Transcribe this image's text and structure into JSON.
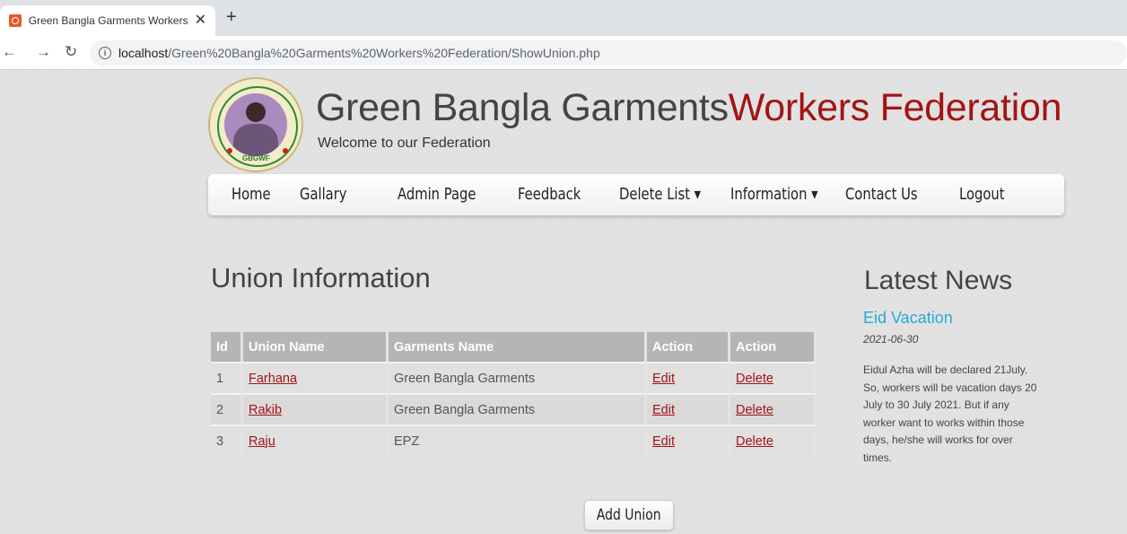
{
  "browser": {
    "tab_title": "Green Bangla Garments Workers",
    "url_host": "localhost",
    "url_path": "/Green%20Bangla%20Garments%20Workers%20Federation/ShowUnion.php"
  },
  "site": {
    "title_part1": "Green Bangla Garments",
    "title_part2": "Workers Federation",
    "subtitle": "Welcome to our Federation",
    "logo_abbr": "GBGWF"
  },
  "nav": {
    "items": [
      {
        "label": "Home"
      },
      {
        "label": "Gallary"
      },
      {
        "label": "Admin Page"
      },
      {
        "label": "Feedback"
      },
      {
        "label": "Delete List ▾"
      },
      {
        "label": "Information ▾"
      },
      {
        "label": "Contact Us"
      },
      {
        "label": "Logout"
      }
    ]
  },
  "union": {
    "title": "Union Information",
    "columns": [
      "Id",
      "Union Name",
      "Garments Name",
      "Action",
      "Action"
    ],
    "rows": [
      {
        "id": "1",
        "name": "Farhana",
        "garments": "Green Bangla Garments",
        "edit": "Edit",
        "delete": "Delete"
      },
      {
        "id": "2",
        "name": "Rakib",
        "garments": "Green Bangla Garments",
        "edit": "Edit",
        "delete": "Delete"
      },
      {
        "id": "3",
        "name": "Raju",
        "garments": "EPZ",
        "edit": "Edit",
        "delete": "Delete"
      }
    ],
    "add_button": "Add Union"
  },
  "news": {
    "title": "Latest News",
    "headline": "Eid Vacation",
    "date": "2021-06-30",
    "body": "Eidul Azha will be declared 21July. So, workers will be vacation days 20 July to 30 July 2021. But if any worker want to works within those days, he/she will works for over times."
  }
}
